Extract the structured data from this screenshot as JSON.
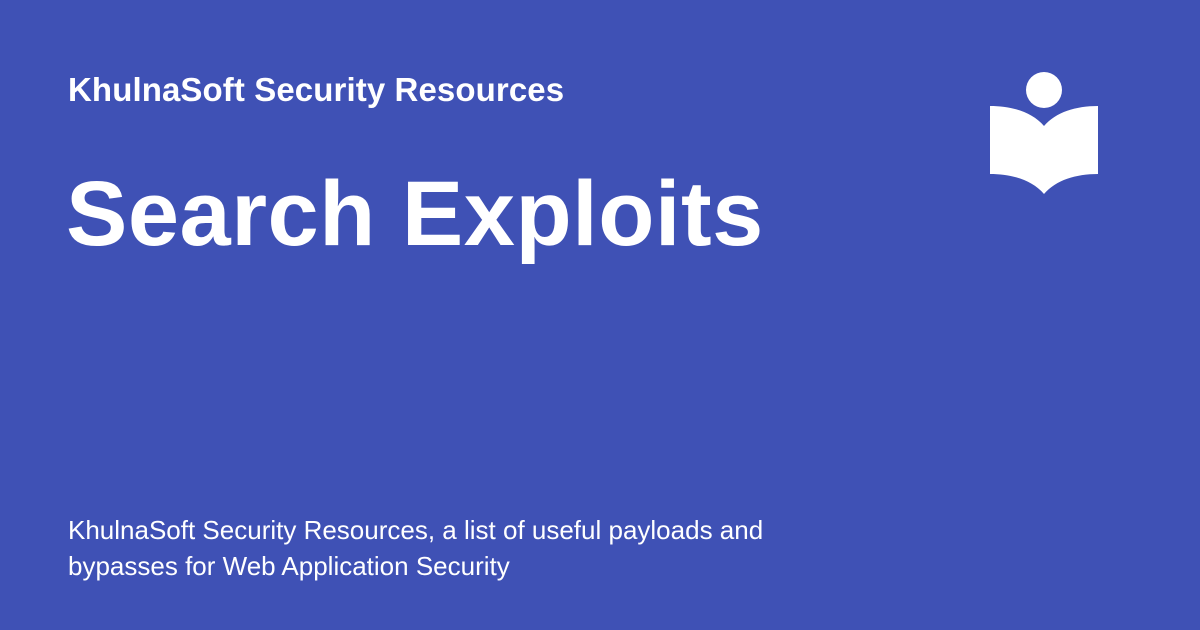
{
  "card": {
    "site_name": "KhulnaSoft Security Resources",
    "title": "Search Exploits",
    "description": "KhulnaSoft Security Resources, a list of useful payloads and bypasses for Web Application Security",
    "logo_icon": "reader-book-icon",
    "background_color": "#3f51b5",
    "text_color": "#ffffff"
  }
}
